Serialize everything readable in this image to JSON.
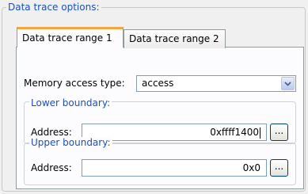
{
  "group": {
    "title": "Data trace options:"
  },
  "tabs": [
    {
      "label": "Data trace range 1",
      "active": true
    },
    {
      "label": "Data trace range 2",
      "active": false
    }
  ],
  "memory_access": {
    "label": "Memory access type:",
    "value": "access"
  },
  "lower": {
    "title": "Lower boundary:",
    "address_label": "Address:",
    "address_value": "0xffff1400",
    "browse_label": "..."
  },
  "upper": {
    "title": "Upper boundary:",
    "address_label": "Address:",
    "address_value": "0x0",
    "browse_label": "..."
  },
  "icons": {
    "dropdown": "chevron-down-icon"
  },
  "colors": {
    "legend_text": "#1c4fb8",
    "active_tab_accent": "#f2a541",
    "field_border": "#7f9db9"
  }
}
